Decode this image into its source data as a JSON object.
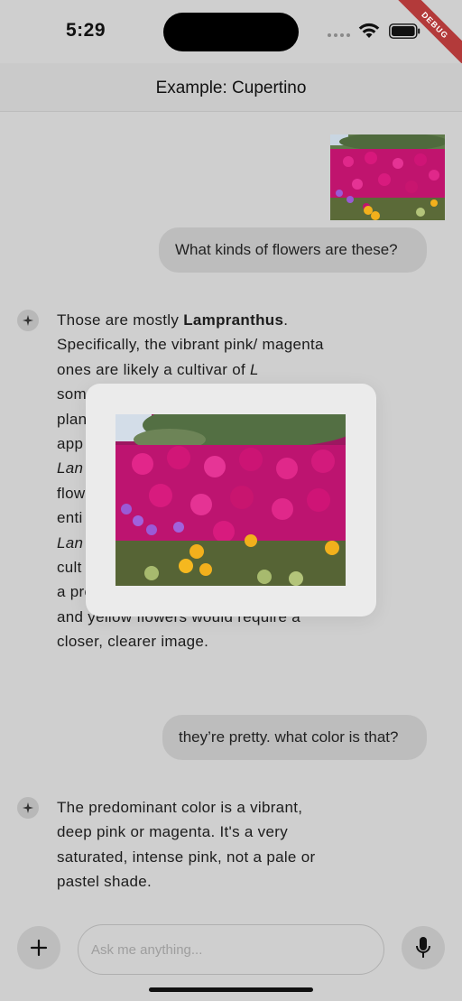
{
  "status": {
    "time": "5:29",
    "debug_label": "DEBUG"
  },
  "nav": {
    "title": "Example: Cupertino"
  },
  "messages": {
    "user1": "What kinds of flowers are these?",
    "ai1": {
      "p1_pre": "Those are mostly ",
      "p1_bold": "Lampranthus",
      "p1_post": ". Specifically, the vibrant pink/ magenta ones are likely a cultivar of ",
      "p1_italic": "L",
      "rest_lines": [
        "som",
        "plan",
        "app",
        "Lan",
        "flow",
        "enti",
        "Lan",
        "cult"
      ],
      "tail": "a precise identification of the purple and yellow flowers would require a closer, clearer image."
    },
    "user2": "they’re pretty. what color is that?",
    "ai2": "The predominant color is a vibrant, deep pink or magenta.  It's a very saturated, intense pink, not a pale or pastel shade."
  },
  "input": {
    "placeholder": "Ask me anything..."
  },
  "icons": {
    "ai": "sparkle-icon",
    "plus": "plus-icon",
    "mic": "microphone-icon",
    "wifi": "wifi-icon",
    "battery": "battery-icon"
  }
}
